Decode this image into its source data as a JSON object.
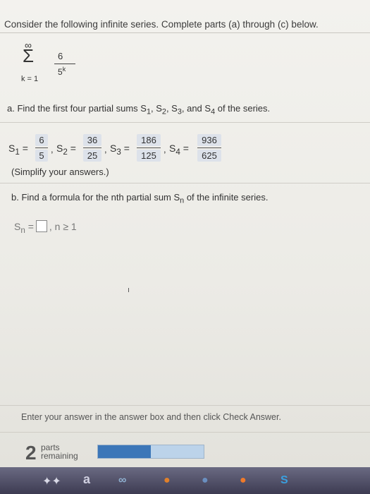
{
  "problem": {
    "intro": "Consider the following infinite series. Complete parts (a) through (c) below.",
    "series": {
      "upper": "∞",
      "sigma": "Σ",
      "lower": "k = 1",
      "numerator": "6",
      "denominator_base": "5",
      "denominator_exp": "k"
    },
    "part_a": {
      "text": "a. Find the first four partial sums S",
      "sums": [
        {
          "label": "S",
          "sub": "1",
          "eq": " =",
          "num": "6",
          "den": "5"
        },
        {
          "label": "S",
          "sub": "2",
          "eq": " =",
          "num": "36",
          "den": "25"
        },
        {
          "label": "S",
          "sub": "3",
          "eq": " =",
          "num": "186",
          "den": "125"
        },
        {
          "label": "S",
          "sub": "4",
          "eq": " =",
          "num": "936",
          "den": "625"
        }
      ],
      "simplify": "(Simplify your answers.)"
    },
    "part_b": {
      "text": "b. Find a formula for the nth partial sum S",
      "text_sub": "n",
      "text_end": " of the infinite series.",
      "answer_label": "S",
      "answer_sub": "n",
      "answer_eq": " =",
      "answer_value": "",
      "condition": ", n ≥ 1"
    }
  },
  "footer": {
    "instruction": "Enter your answer in the answer box and then click Check Answer.",
    "parts_count": "2",
    "parts_label_1": "parts",
    "parts_label_2": "remaining",
    "progress_fraction": 0.5
  },
  "taskbar": {
    "items": [
      "✦✦",
      "a",
      "∞",
      "●",
      "●",
      "●",
      "S"
    ]
  },
  "colors": {
    "progress_fill": "#3c76b8",
    "progress_track": "#bcd3ea",
    "answer_box_bg": "#dde2ea"
  }
}
